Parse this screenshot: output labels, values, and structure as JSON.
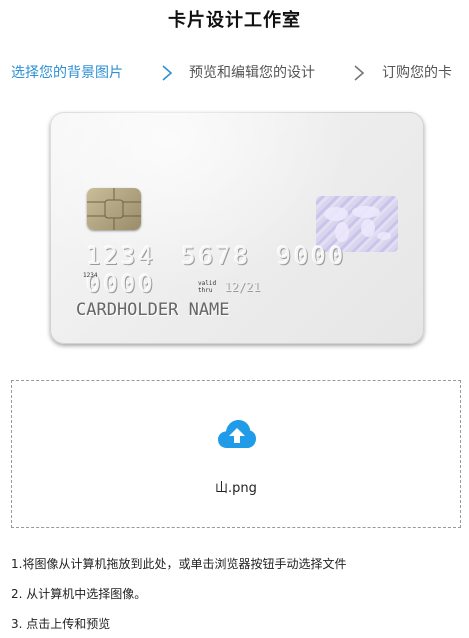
{
  "page": {
    "title": "卡片设计工作室"
  },
  "steps": [
    {
      "label": "选择您的背景图片",
      "active": true
    },
    {
      "label": "预览和编辑您的设计",
      "active": false
    },
    {
      "label": "订购您的卡",
      "active": false
    }
  ],
  "card": {
    "number": "1234 5678 9000 0000",
    "small_number": "1234",
    "valid_label_1": "valid",
    "valid_label_2": "thru",
    "expiry": "12/21",
    "cardholder": "CARDHOLDER NAME"
  },
  "upload": {
    "filename": "山.png",
    "icon": "cloud-upload-icon",
    "accent_color": "#1f9be8"
  },
  "instructions": [
    "1.将图像从计算机拖放到此处，或单击浏览器按钮手动选择文件",
    "2. 从计算机中选择图像。",
    "3. 点击上传和预览"
  ]
}
